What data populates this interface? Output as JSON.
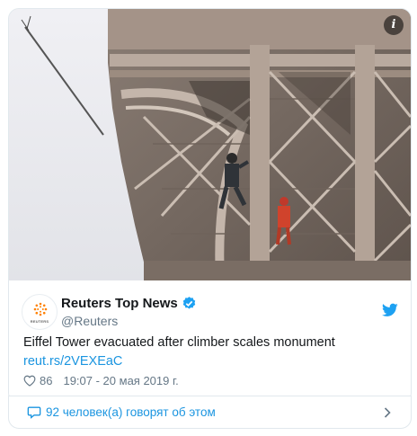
{
  "media": {
    "alt_icon": "info-circle-icon",
    "info_label": "i"
  },
  "author": {
    "name": "Reuters Top News",
    "handle": "@Reuters",
    "avatar_wordmark": "REUTERS",
    "verified_icon": "verified-badge-icon",
    "brand_icon": "twitter-bird-icon"
  },
  "tweet": {
    "text": "Eiffel Tower evacuated after climber scales monument",
    "link": "reut.rs/2VEXEaC",
    "likes": "86",
    "timestamp": "19:07 - 20 мая 2019 г."
  },
  "footer": {
    "talking_text": "92 человек(а) говорят об этом"
  },
  "colors": {
    "accent": "#1da1f2",
    "link": "#1b95e0",
    "secondary": "#657786",
    "reuters_orange": "#ff8000"
  }
}
